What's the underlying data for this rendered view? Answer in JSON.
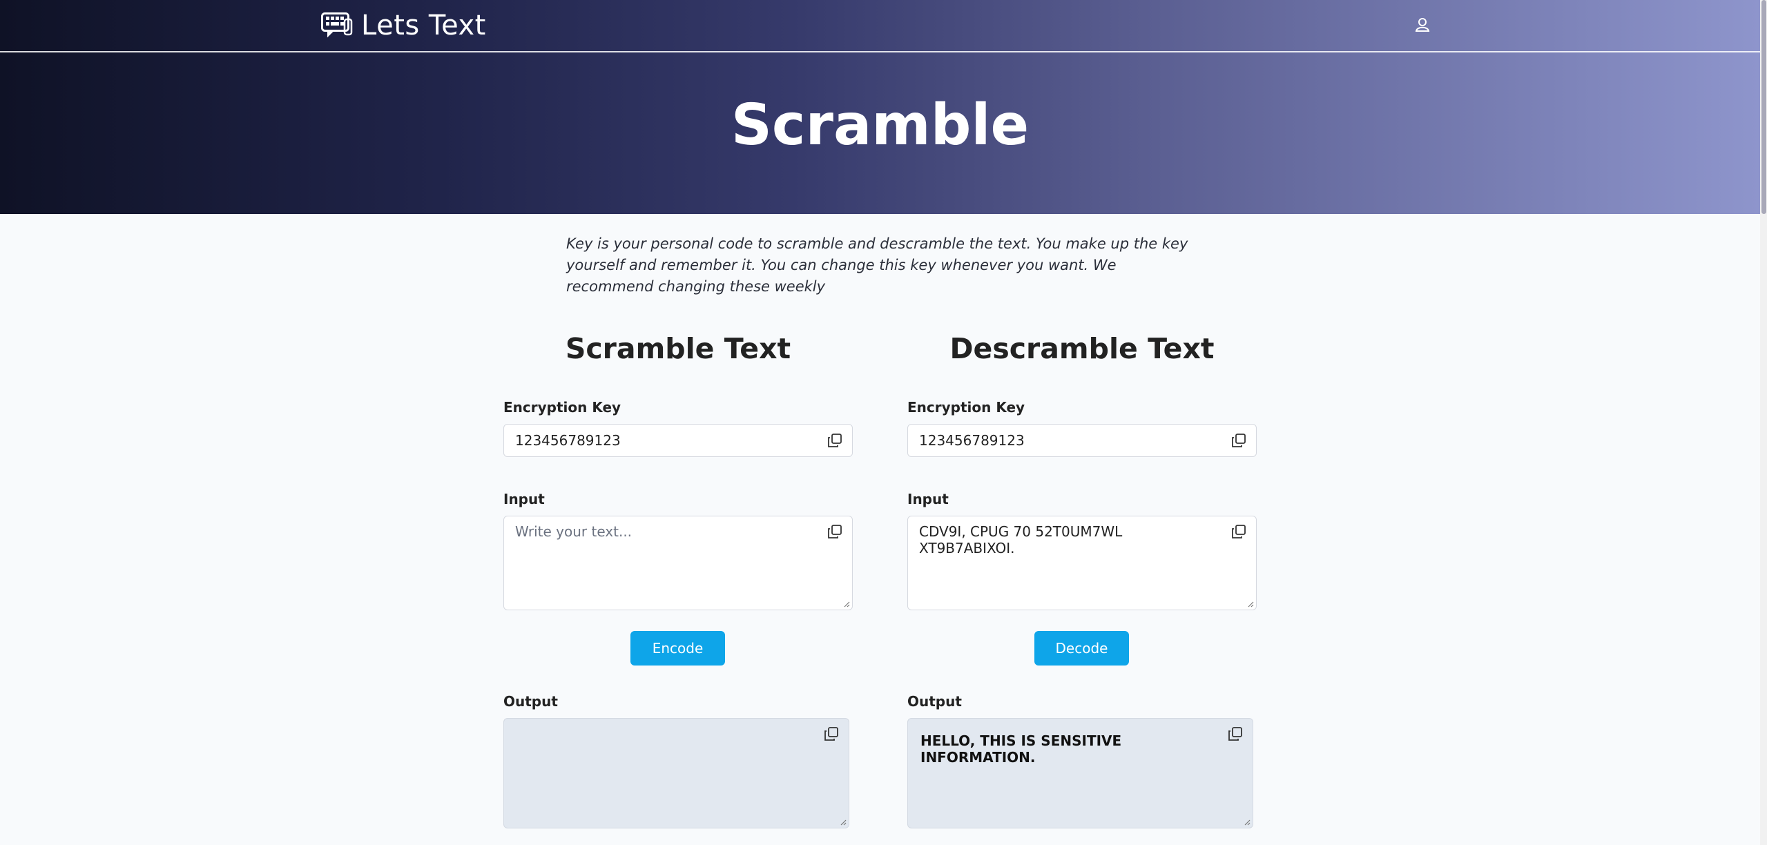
{
  "nav": {
    "brand_name": "Lets Text",
    "brand_icon": "chat-keyboard-logo-icon",
    "user_icon": "user-icon"
  },
  "hero": {
    "title": "Scramble"
  },
  "description": "Key is your personal code to scramble and descramble the text. You make up the key yourself and remember it. You can change this key whenever you want. We recommend changing these weekly",
  "scramble": {
    "title": "Scramble Text",
    "key_label": "Encryption Key",
    "key_value": "123456789123",
    "input_label": "Input",
    "input_placeholder": "Write your text...",
    "input_value": "",
    "button_label": "Encode",
    "output_label": "Output",
    "output_value": ""
  },
  "descramble": {
    "title": "Descramble Text",
    "key_label": "Encryption Key",
    "key_value": "123456789123",
    "input_label": "Input",
    "input_placeholder": "",
    "input_value": "CDV9I, CPUG 70 52T0UM7WL XT9B7ABIXOI.",
    "button_label": "Decode",
    "output_label": "Output",
    "output_value": "HELLO, THIS IS SENSITIVE INFORMATION."
  },
  "colors": {
    "accent_button": "#0ea5e9",
    "hero_gradient_start": "#0f1226",
    "hero_gradient_end": "#8e95cc",
    "output_background": "#e2e8f0"
  }
}
